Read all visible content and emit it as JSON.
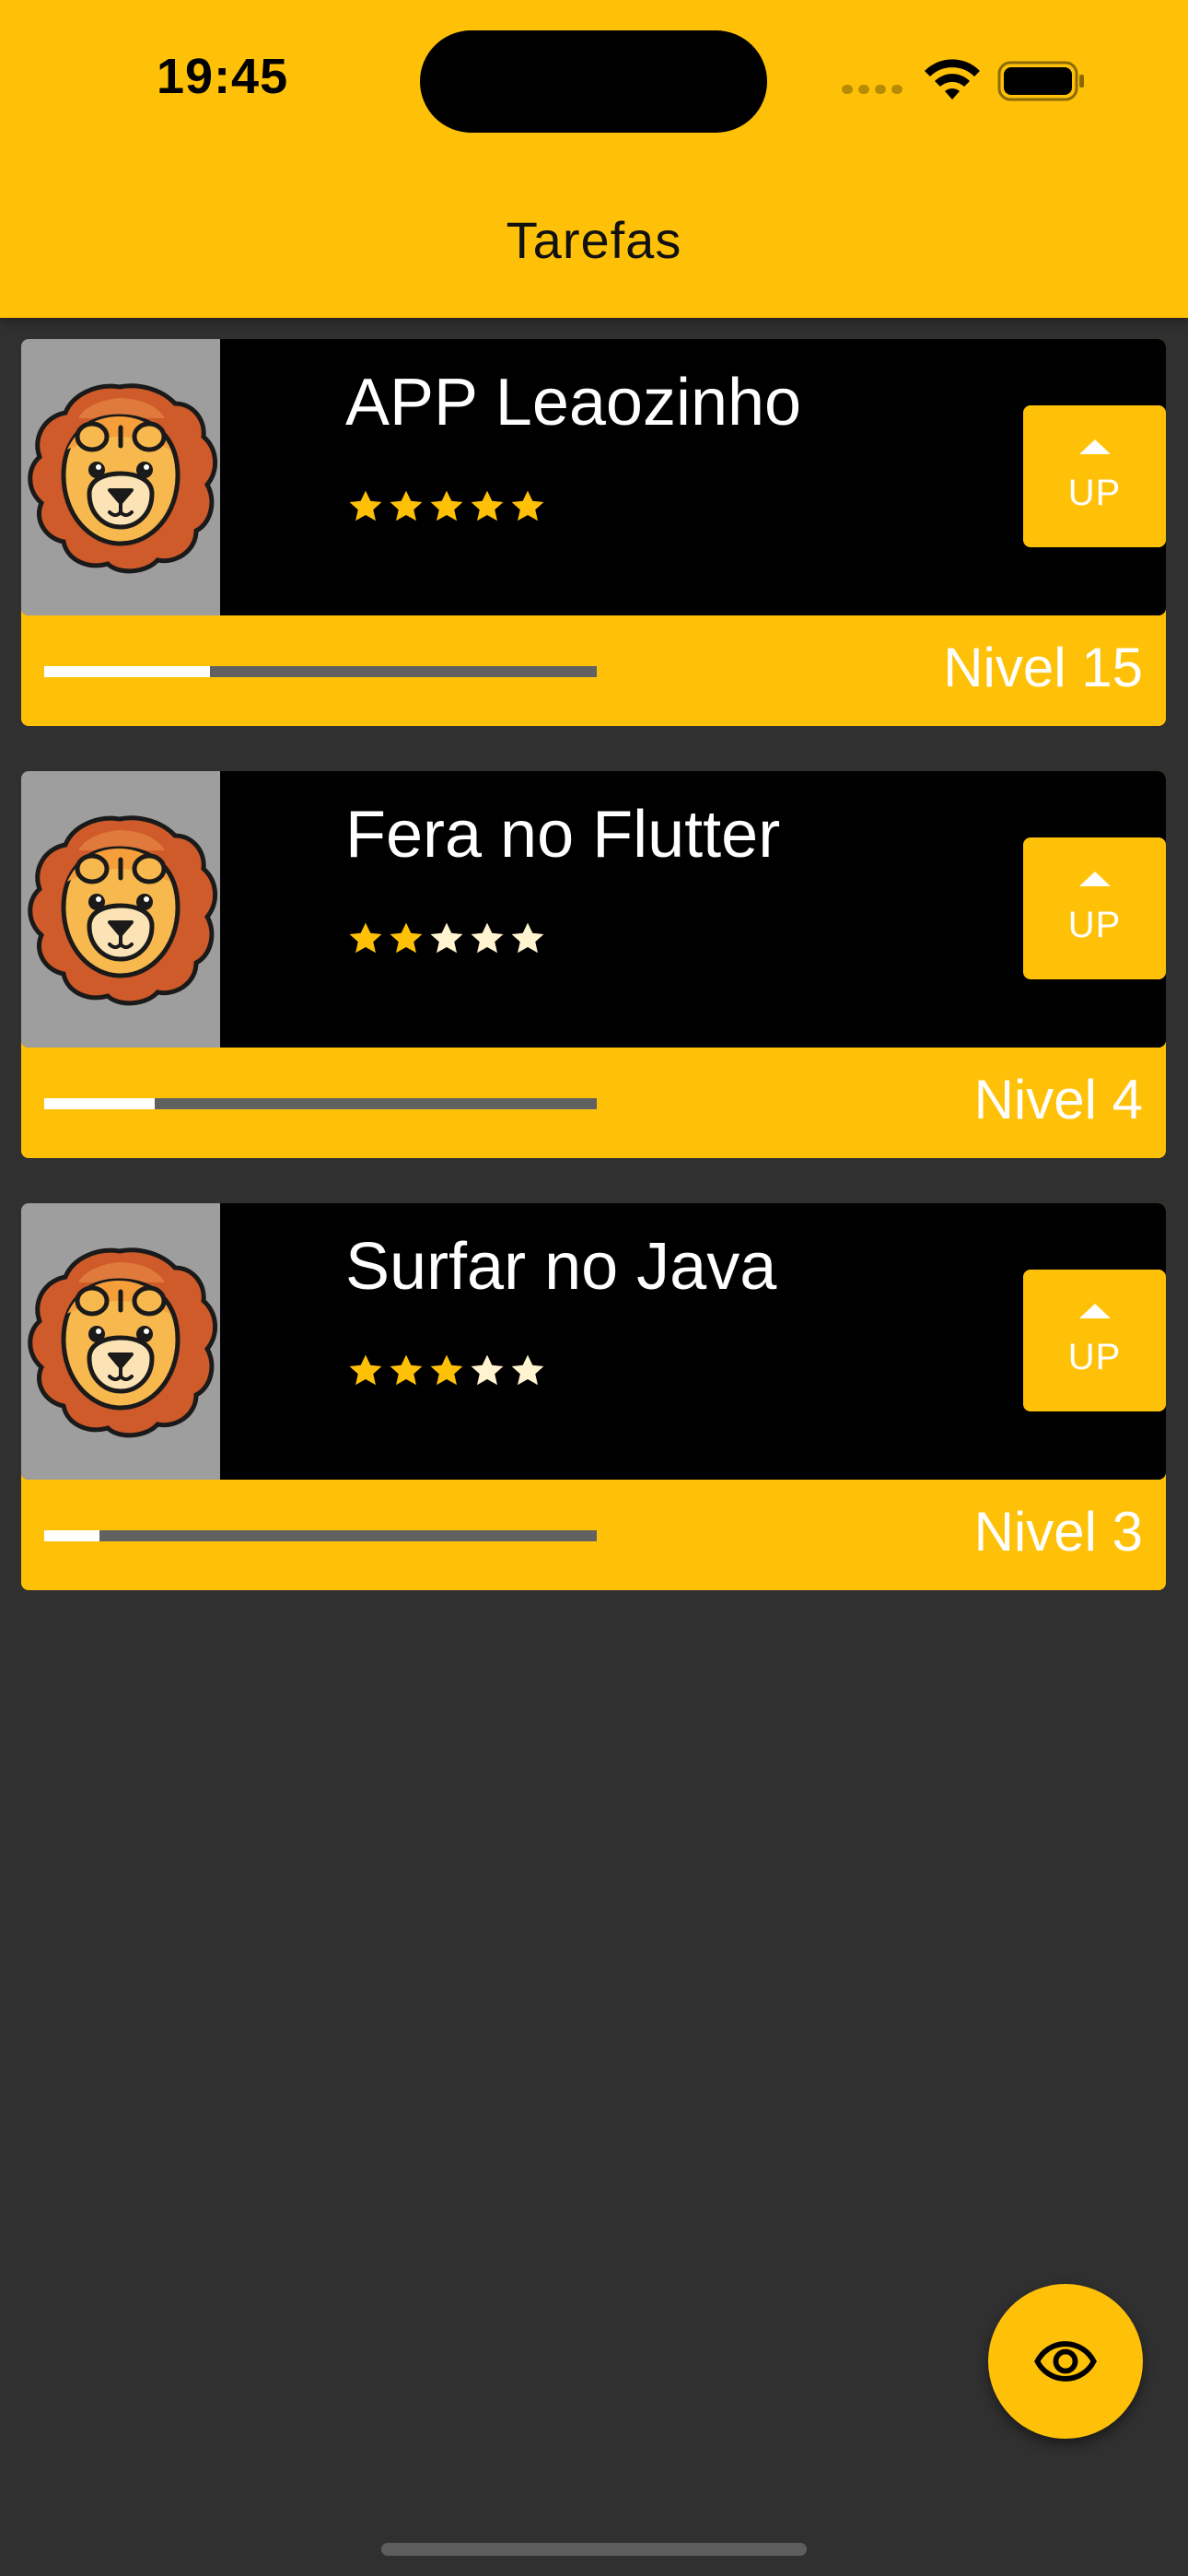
{
  "status_bar": {
    "time": "19:45"
  },
  "app_bar": {
    "title": "Tarefas"
  },
  "tasks": [
    {
      "name": "APP Leaozinho",
      "difficulty": 5,
      "max_difficulty": 5,
      "up_label": "UP",
      "level_label": "Nivel 15",
      "progress": 0.3
    },
    {
      "name": "Fera no Flutter",
      "difficulty": 2,
      "max_difficulty": 5,
      "up_label": "UP",
      "level_label": "Nivel 4",
      "progress": 0.2
    },
    {
      "name": "Surfar no Java",
      "difficulty": 3,
      "max_difficulty": 5,
      "up_label": "UP",
      "level_label": "Nivel 3",
      "progress": 0.1
    }
  ],
  "fab": {
    "icon": "eye-icon"
  },
  "colors": {
    "accent": "#FFC107",
    "background": "#303030",
    "card_top": "#000000",
    "star_filled": "#FFC107",
    "star_empty": "#FFF3D0",
    "progress_track": "#616161",
    "progress_fill": "#FFFFFF"
  }
}
